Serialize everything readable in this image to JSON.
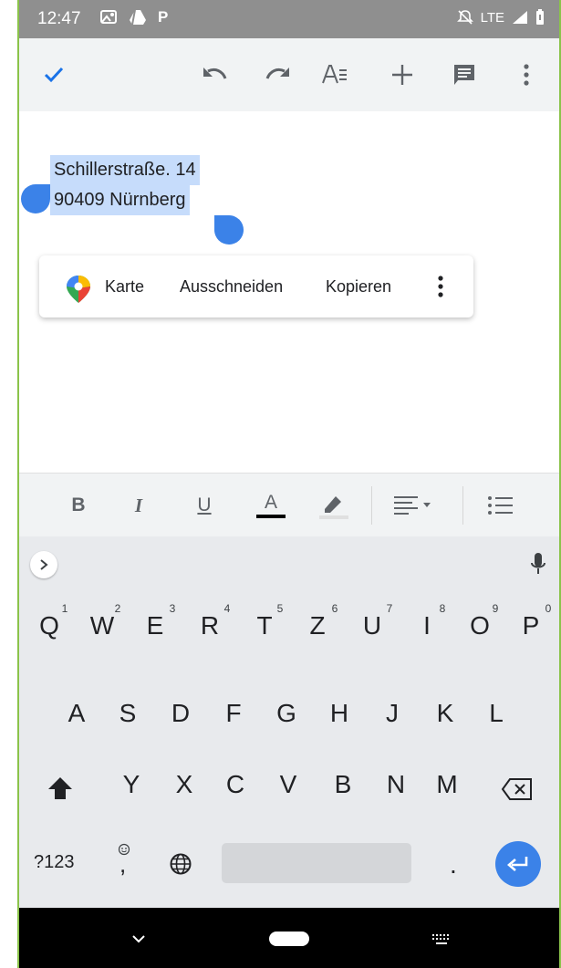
{
  "status_bar": {
    "time": "12:47",
    "left_icons": [
      "photos-icon",
      "drive-icon",
      "parking-icon"
    ],
    "network": "LTE",
    "right_icons": [
      "mute-icon",
      "signal-icon",
      "battery-icon"
    ]
  },
  "toolbar": {
    "buttons": [
      "check-icon",
      "undo-icon",
      "redo-icon",
      "text-format-icon",
      "insert-icon",
      "comment-icon",
      "more-vert-icon"
    ],
    "accent_color": "#1a73e8"
  },
  "document": {
    "lines": [
      "Schillerstraße. 14",
      "90409 Nürnberg"
    ],
    "selection_color": "#c6dcfb",
    "handle_color": "#3b82e8"
  },
  "context_menu": {
    "items": [
      "Karte",
      "Ausschneiden",
      "Kopieren"
    ]
  },
  "format_bar": {
    "bold": "B",
    "italic": "I",
    "underline": "U",
    "text_color": "A"
  },
  "keyboard": {
    "row1": [
      "Q",
      "W",
      "E",
      "R",
      "T",
      "Z",
      "U",
      "I",
      "O",
      "P"
    ],
    "row1_hints": [
      "1",
      "2",
      "3",
      "4",
      "5",
      "6",
      "7",
      "8",
      "9",
      "0"
    ],
    "row2": [
      "A",
      "S",
      "D",
      "F",
      "G",
      "H",
      "J",
      "K",
      "L"
    ],
    "row3": [
      "Y",
      "X",
      "C",
      "V",
      "B",
      "N",
      "M"
    ],
    "symbols_key": "?123",
    "comma_key": ",",
    "period_key": ".",
    "enter_color": "#3b82e8"
  }
}
